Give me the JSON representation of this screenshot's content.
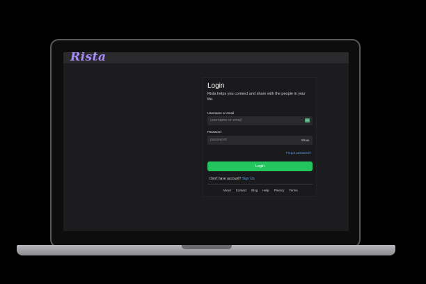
{
  "app": {
    "logo_text": "Rista"
  },
  "login": {
    "title": "Login",
    "description": "Rista helps you connect and share with the people in your life.",
    "username_label": "Username or email",
    "username_placeholder": "username or email",
    "password_label": "Password",
    "password_placeholder": "password",
    "show_label": "Show",
    "forgot_label": "Forgot password?",
    "submit_label": "Login",
    "signup_prompt": "Don't have account?",
    "signup_link": "Sign Up"
  },
  "footer": {
    "links": [
      "About",
      "Contact",
      "Blog",
      "Help",
      "Privacy",
      "Terms"
    ]
  },
  "colors": {
    "accent": "#22c55e",
    "link": "#5b9cf0",
    "logo": "#a78bfa",
    "background": "#1c1c1e"
  }
}
